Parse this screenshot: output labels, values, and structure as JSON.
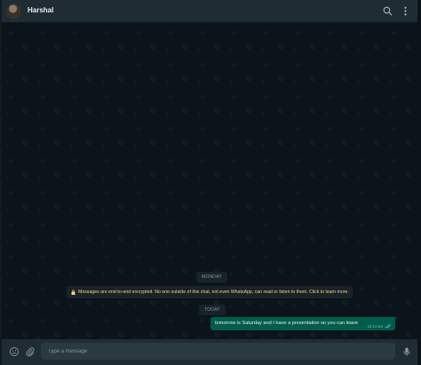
{
  "header": {
    "contact_name": "Harshal",
    "search_icon": "search-icon",
    "menu_icon": "kebab-menu-icon"
  },
  "chat": {
    "date_monday": "MONDAY",
    "encryption_notice": "Messages are end-to-end encrypted. No one outside of this chat, not even WhatsApp, can read or listen to them. Click to learn more.",
    "date_today": "TODAY",
    "messages": [
      {
        "text": "tomorrow is Saturday and I have a presentation so you can leave",
        "time": "12:14 am",
        "status": "read"
      }
    ]
  },
  "composer": {
    "placeholder": "Type a message",
    "value": ""
  },
  "colors": {
    "header_bg": "#202c33",
    "chat_bg": "#0b141a",
    "outgoing_bubble": "#005c4b",
    "encryption_text": "#ffd279",
    "read_ticks": "#53bdeb"
  }
}
